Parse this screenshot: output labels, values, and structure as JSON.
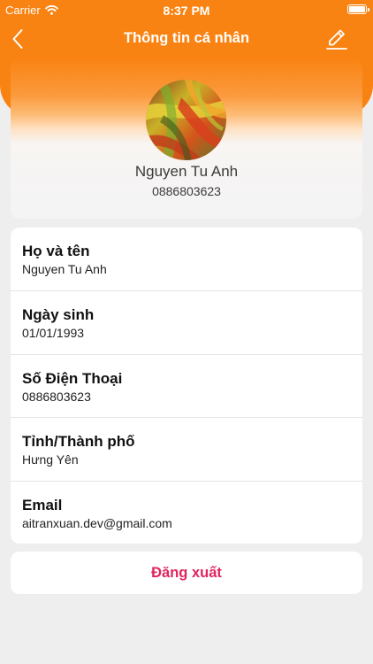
{
  "status_bar": {
    "carrier": "Carrier",
    "time": "8:37 PM",
    "wifi_icon": "wifi-icon",
    "battery_icon": "battery-icon"
  },
  "nav": {
    "title": "Thông tin cá nhân",
    "back_icon": "chevron-left-icon",
    "edit_icon": "pencil-icon"
  },
  "profile": {
    "name": "Nguyen Tu Anh",
    "phone": "0886803623"
  },
  "info_fields": [
    {
      "label": "Họ và tên",
      "value": "Nguyen Tu Anh"
    },
    {
      "label": "Ngày sinh",
      "value": "01/01/1993"
    },
    {
      "label": "Số Điện Thoại",
      "value": "0886803623"
    },
    {
      "label": "Tỉnh/Thành phố",
      "value": "Hưng Yên"
    },
    {
      "label": "Email",
      "value": "aitranxuan.dev@gmail.com"
    }
  ],
  "logout_label": "Đăng xuất",
  "colors": {
    "accent": "#f98312",
    "logout": "#e0245e",
    "background": "#eeeeef"
  }
}
